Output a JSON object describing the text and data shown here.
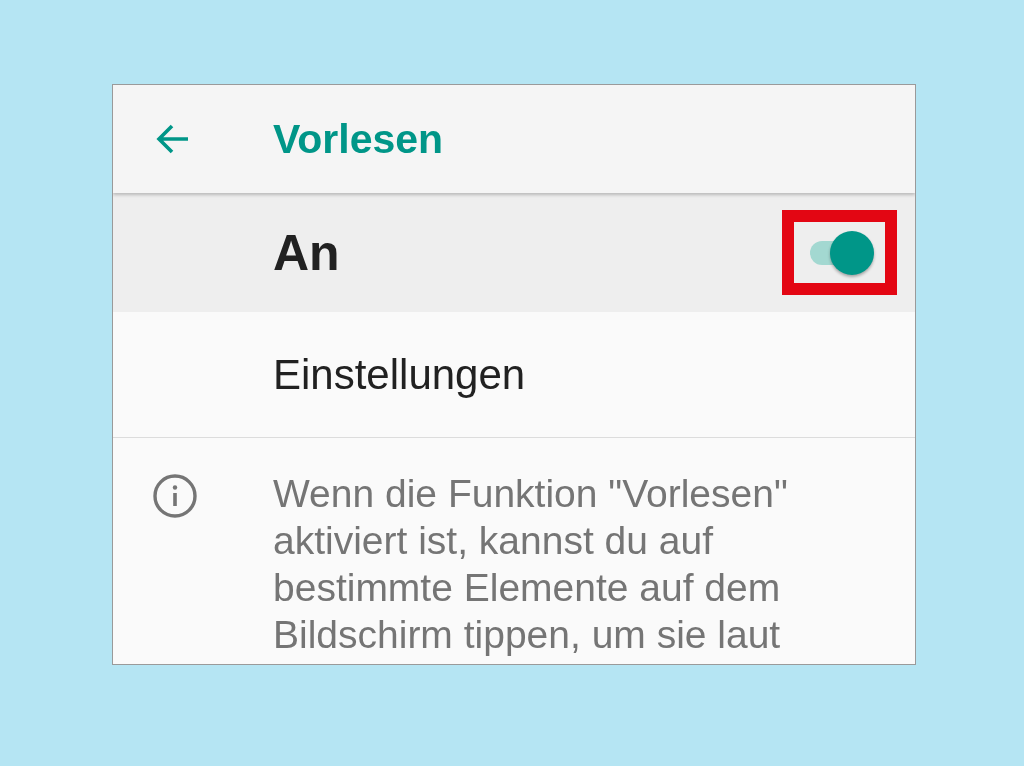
{
  "header": {
    "title": "Vorlesen"
  },
  "main_switch": {
    "label": "An",
    "on": true,
    "highlighted": true
  },
  "menu_items": [
    {
      "label": "Einstellungen"
    }
  ],
  "info": {
    "text": "Wenn die Funktion \"Vorlesen\"\naktiviert ist, kannst du auf\nbestimmte Elemente auf dem\nBildschirm tippen, um sie laut"
  }
}
